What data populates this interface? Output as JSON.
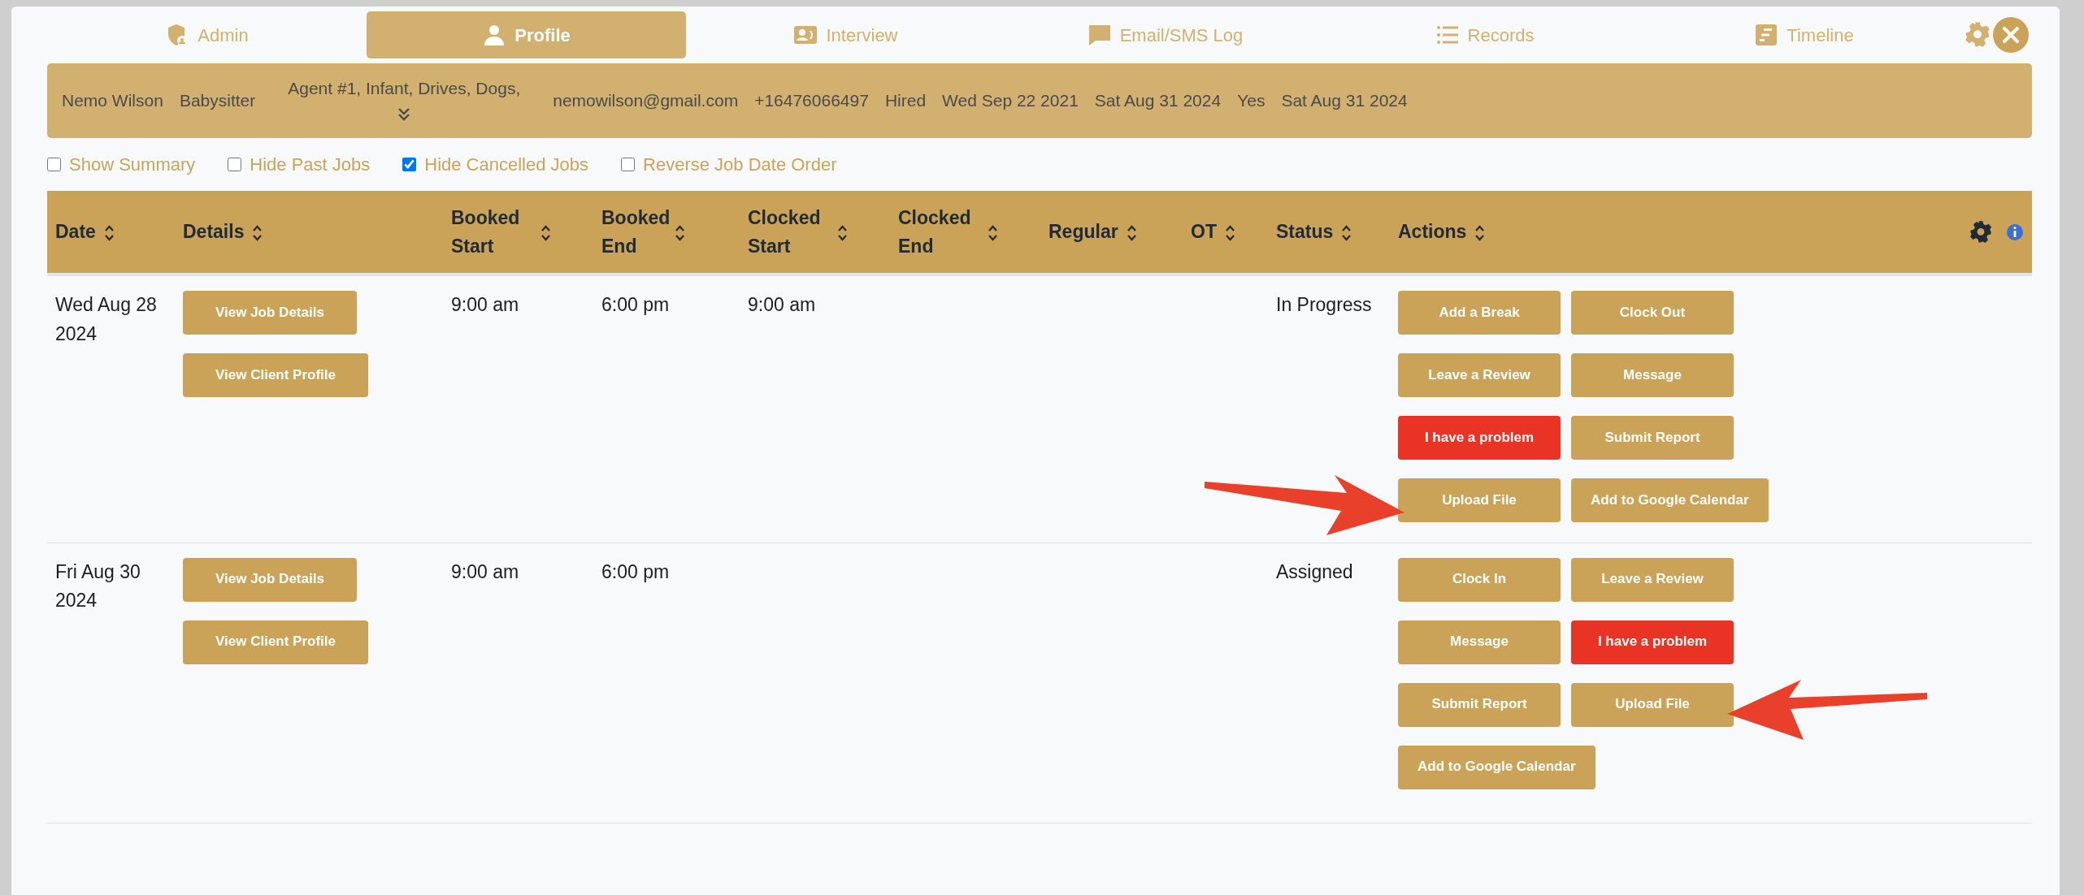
{
  "tabs": [
    {
      "label": "Admin",
      "selected": false
    },
    {
      "label": "Profile",
      "selected": true
    },
    {
      "label": "Interview",
      "selected": false
    },
    {
      "label": "Email/SMS Log",
      "selected": false
    },
    {
      "label": "Records",
      "selected": false
    },
    {
      "label": "Timeline",
      "selected": false
    }
  ],
  "profile_bar": {
    "fields": [
      {
        "text": "Nemo Wilson",
        "expandable": false
      },
      {
        "text": "Babysitter",
        "expandable": false
      },
      {
        "text": "Agent #1, Infant, Drives, Dogs,",
        "expandable": true
      },
      {
        "text": "nemowilson@gmail.com",
        "expandable": false
      },
      {
        "text": "+16476066497",
        "expandable": false
      },
      {
        "text": "Hired",
        "expandable": false
      },
      {
        "text": "Wed Sep 22 2021",
        "expandable": false
      },
      {
        "text": "Sat Aug 31 2024",
        "expandable": false
      },
      {
        "text": "Yes",
        "expandable": false
      },
      {
        "text": "Sat Aug 31 2024",
        "expandable": false
      }
    ]
  },
  "filters": [
    {
      "label": "Show Summary",
      "checked": false
    },
    {
      "label": "Hide Past Jobs",
      "checked": false
    },
    {
      "label": "Hide Cancelled Jobs",
      "checked": true
    },
    {
      "label": "Reverse Job Date Order",
      "checked": false
    }
  ],
  "table": {
    "columns": [
      "Date",
      "Details",
      "Booked Start",
      "Booked End",
      "Clocked Start",
      "Clocked End",
      "Regular",
      "OT",
      "Status",
      "Actions"
    ],
    "rows": [
      {
        "date": "Wed Aug 28 2024",
        "details": [
          "View Job Details",
          "View Client Profile"
        ],
        "booked_start": "9:00 am",
        "booked_end": "6:00 pm",
        "clocked_start": "9:00 am",
        "status": "In Progress",
        "actions": [
          {
            "label": "Add a Break",
            "kind": "primary",
            "highlighted": false
          },
          {
            "label": "Clock Out",
            "kind": "primary",
            "highlighted": false
          },
          {
            "label": "Leave a Review",
            "kind": "primary",
            "highlighted": false
          },
          {
            "label": "Message",
            "kind": "primary",
            "highlighted": false
          },
          {
            "label": "I have a problem",
            "kind": "danger",
            "highlighted": false
          },
          {
            "label": "Submit Report",
            "kind": "primary",
            "highlighted": false
          },
          {
            "label": "Upload File",
            "kind": "primary",
            "highlighted": true
          },
          {
            "label": "Add to Google Calendar",
            "kind": "primary",
            "highlighted": false
          }
        ]
      },
      {
        "date": "Fri Aug 30 2024",
        "details": [
          "View Job Details",
          "View Client Profile"
        ],
        "booked_start": "9:00 am",
        "booked_end": "6:00 pm",
        "clocked_start": "",
        "status": "Assigned",
        "actions": [
          {
            "label": "Clock In",
            "kind": "primary",
            "highlighted": false
          },
          {
            "label": "Leave a Review",
            "kind": "primary",
            "highlighted": false
          },
          {
            "label": "Message",
            "kind": "primary",
            "highlighted": false
          },
          {
            "label": "I have a problem",
            "kind": "danger",
            "highlighted": false
          },
          {
            "label": "Submit Report",
            "kind": "primary",
            "highlighted": false
          },
          {
            "label": "Upload File",
            "kind": "primary",
            "highlighted": true
          },
          {
            "label": "Add to Google Calendar",
            "kind": "primary",
            "highlighted": false
          }
        ]
      }
    ]
  }
}
